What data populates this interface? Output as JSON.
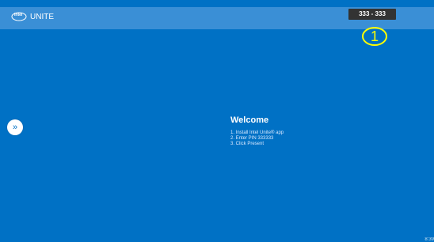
{
  "header": {
    "brand_text": "UNITE",
    "logo_text": "intel",
    "pin_badge": "333 - 333"
  },
  "overlay": {
    "marker_label": "1"
  },
  "sidebar": {
    "toggle_icon": "»"
  },
  "main": {
    "welcome_title": "Welcome",
    "steps": [
      "1. Install Intel Unite® app",
      "2. Enter PIN 333333",
      "3. Click Present"
    ]
  },
  "footer": {
    "time_partial": "8:39"
  },
  "colors": {
    "background": "#0071c5",
    "topbar": "#3a8fd6",
    "badge": "#333333",
    "marker": "#ffff00"
  }
}
